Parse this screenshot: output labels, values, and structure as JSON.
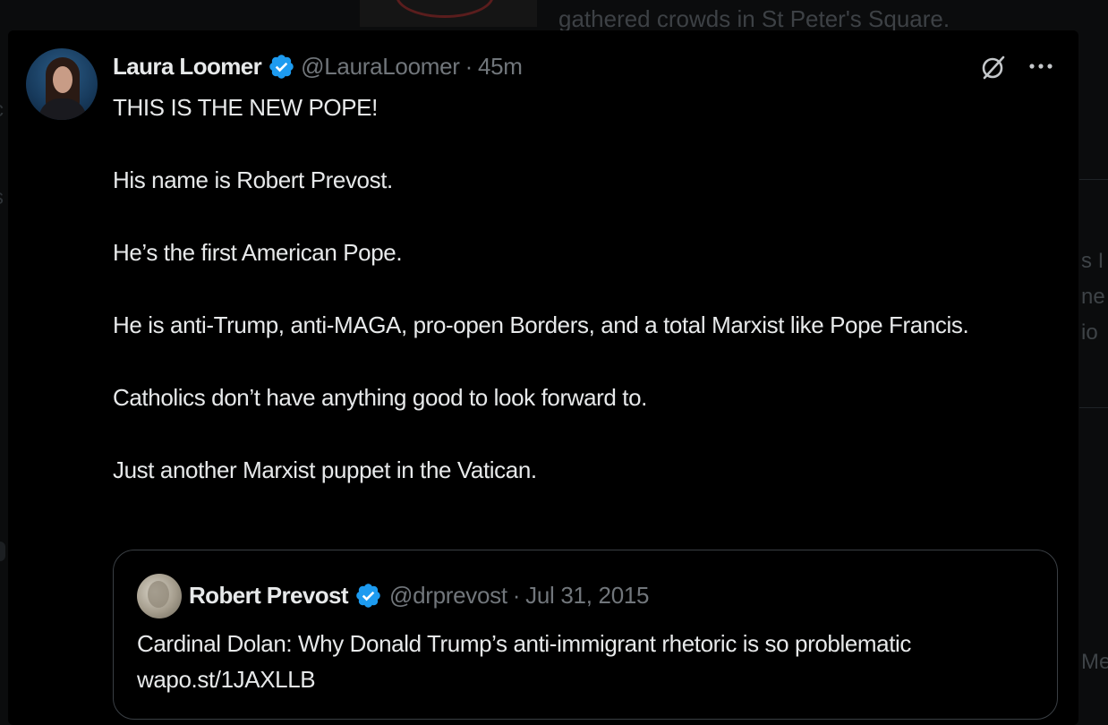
{
  "background": {
    "headline": "gathered crowds in St Peter's Square.",
    "side_fragments": [
      "s I",
      "ne",
      "io",
      "Me"
    ],
    "left_fragments": [
      "c",
      "s"
    ]
  },
  "tweet": {
    "author": {
      "display_name": "Laura Loomer",
      "handle": "@LauraLoomer",
      "verified": true
    },
    "separator": "·",
    "time": "45m",
    "paragraphs": [
      "THIS IS THE NEW POPE!",
      "His name is Robert Prevost.",
      "He’s the first American Pope.",
      "He is anti-Trump, anti-MAGA, pro-open Borders, and a total Marxist like Pope Francis.",
      "Catholics don’t have anything good to look forward to.",
      "Just another Marxist puppet in the Vatican."
    ],
    "actions": {
      "grok_icon": "slashed-circle-icon",
      "more_icon": "ellipsis-icon"
    }
  },
  "quote": {
    "author": {
      "display_name": "Robert Prevost",
      "handle": "@drprevost",
      "verified": true
    },
    "separator": "·",
    "date": "Jul 31, 2015",
    "text": "Cardinal Dolan: Why Donald Trump’s anti-immigrant rhetoric is so problematic wapo.st/1JAXLLB"
  },
  "colors": {
    "background": "#000000",
    "text_primary": "#e7e9ea",
    "text_secondary": "#71767b",
    "verified_blue": "#1d9bf0",
    "quote_border": "#3a3f44"
  }
}
